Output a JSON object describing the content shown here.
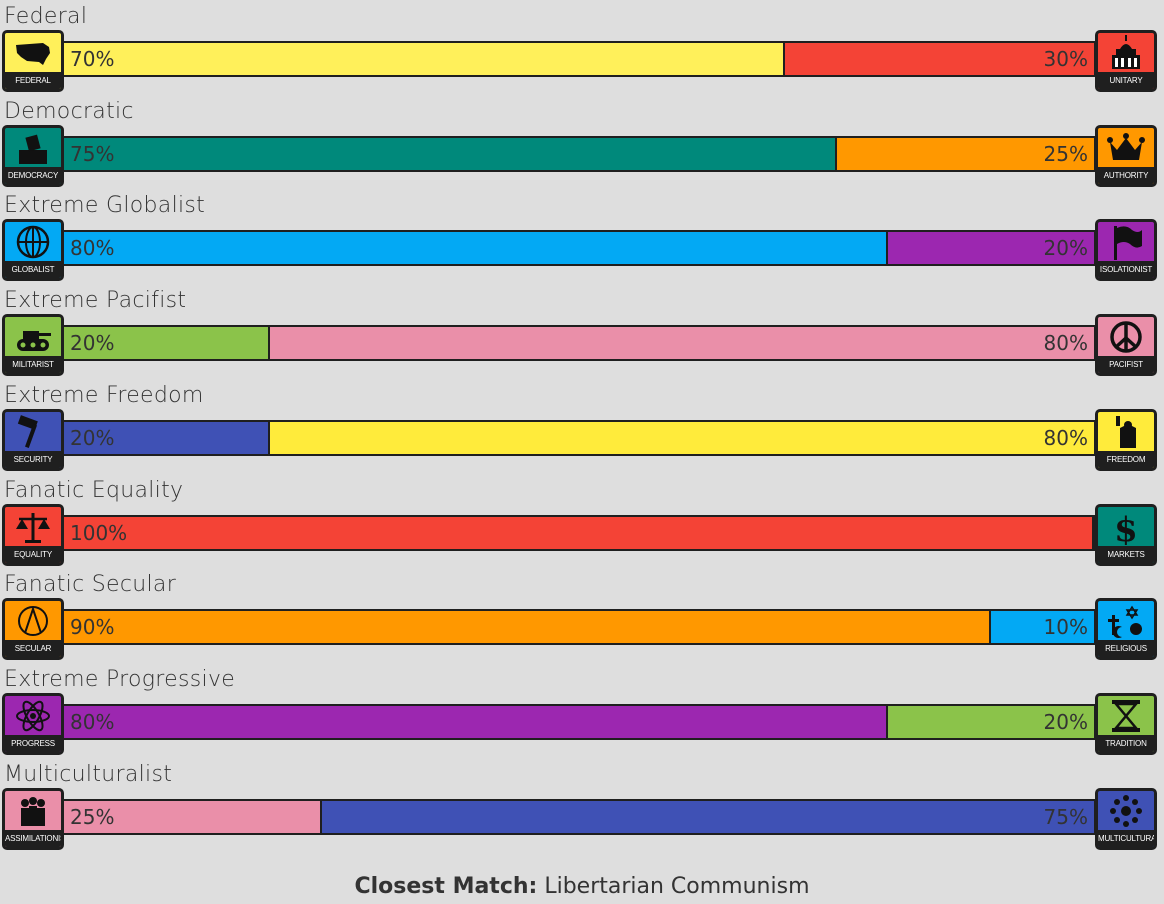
{
  "chart_data": {
    "type": "bar",
    "orientation": "horizontal-stacked",
    "axes": [
      {
        "title": "Federal",
        "left": {
          "label": "FEDERAL",
          "icon": "usa-map-icon",
          "color": "#fff05a",
          "value": 70,
          "value_label": "70%"
        },
        "right": {
          "label": "UNITARY",
          "icon": "capitol-building-icon",
          "color": "#f44336",
          "value": 30,
          "value_label": "30%"
        }
      },
      {
        "title": "Democratic",
        "left": {
          "label": "DEMOCRACY",
          "icon": "ballot-box-icon",
          "color": "#00897b",
          "value": 75,
          "value_label": "75%"
        },
        "right": {
          "label": "AUTHORITY",
          "icon": "crown-icon",
          "color": "#ff9800",
          "value": 25,
          "value_label": "25%"
        }
      },
      {
        "title": "Extreme Globalist",
        "left": {
          "label": "GLOBALIST",
          "icon": "globe-icon",
          "color": "#03a9f4",
          "value": 80,
          "value_label": "80%"
        },
        "right": {
          "label": "ISOLATIONIST",
          "icon": "flag-icon",
          "color": "#9c27b0",
          "value": 20,
          "value_label": "20%"
        }
      },
      {
        "title": "Extreme Pacifist",
        "left": {
          "label": "MILITARIST",
          "icon": "tank-icon",
          "color": "#8bc34a",
          "value": 20,
          "value_label": "20%"
        },
        "right": {
          "label": "PACIFIST",
          "icon": "peace-sign-icon",
          "color": "#ea8fa9",
          "value": 80,
          "value_label": "80%"
        }
      },
      {
        "title": "Extreme Freedom",
        "left": {
          "label": "SECURITY",
          "icon": "gavel-icon",
          "color": "#3f51b5",
          "value": 20,
          "value_label": "20%"
        },
        "right": {
          "label": "FREEDOM",
          "icon": "statue-of-liberty-icon",
          "color": "#ffeb3b",
          "value": 80,
          "value_label": "80%"
        }
      },
      {
        "title": "Fanatic Equality",
        "left": {
          "label": "EQUALITY",
          "icon": "scales-icon",
          "color": "#f44336",
          "value": 100,
          "value_label": "100%"
        },
        "right": {
          "label": "MARKETS",
          "icon": "dollar-sign-icon",
          "color": "#00897b",
          "value": 0,
          "value_label": ""
        }
      },
      {
        "title": "Fanatic Secular",
        "left": {
          "label": "SECULAR",
          "icon": "atheism-symbol-icon",
          "color": "#ff9800",
          "value": 90,
          "value_label": "90%"
        },
        "right": {
          "label": "RELIGIOUS",
          "icon": "religious-symbols-icon",
          "color": "#03a9f4",
          "value": 10,
          "value_label": "10%"
        }
      },
      {
        "title": "Extreme Progressive",
        "left": {
          "label": "PROGRESS",
          "icon": "atom-icon",
          "color": "#9c27b0",
          "value": 80,
          "value_label": "80%"
        },
        "right": {
          "label": "TRADITION",
          "icon": "hourglass-icon",
          "color": "#8bc34a",
          "value": 20,
          "value_label": "20%"
        }
      },
      {
        "title": "Multiculturalist",
        "left": {
          "label": "ASSIMILATIONIST",
          "icon": "crowd-icon",
          "color": "#ea8fa9",
          "value": 25,
          "value_label": "25%"
        },
        "right": {
          "label": "MULTICULTURALIST",
          "icon": "people-circle-icon",
          "color": "#3f51b5",
          "value": 75,
          "value_label": "75%"
        }
      }
    ],
    "xlim": [
      0,
      100
    ]
  },
  "summary": {
    "label": "Closest Match:",
    "value": "Libertarian Communism"
  }
}
